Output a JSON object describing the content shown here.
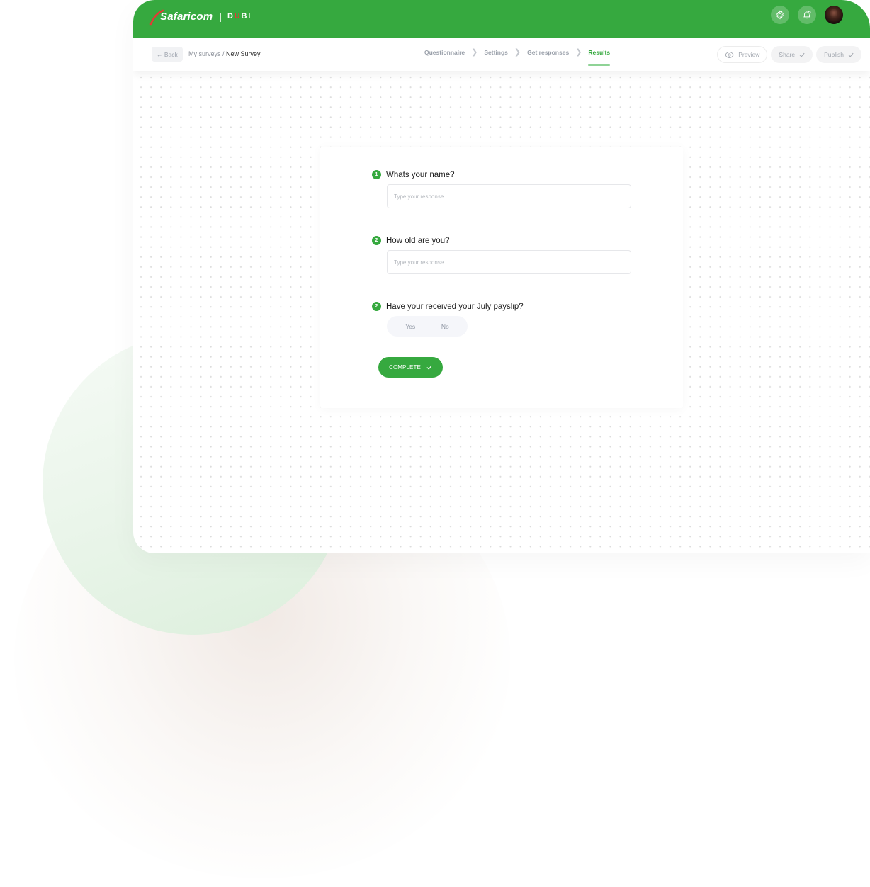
{
  "brand": {
    "name": "Safaricom",
    "separator": "|",
    "product_prefix": "D",
    "product_accent": "U",
    "product_suffix": "BI",
    "primary_color": "#36a93f",
    "accent_color": "#e53935"
  },
  "topbar": {
    "icons": [
      "gear-icon",
      "bell-icon",
      "avatar"
    ]
  },
  "subbar": {
    "back_label": "← Back",
    "breadcrumb": {
      "parent": "My surveys",
      "separator": " / ",
      "current": "New Survey"
    },
    "steps": [
      {
        "label": "Questionnaire",
        "active": false
      },
      {
        "label": "Settings",
        "active": false
      },
      {
        "label": "Get responses",
        "active": false
      },
      {
        "label": "Results",
        "active": true
      }
    ],
    "actions": {
      "preview_label": "Preview",
      "share_label": "Share",
      "publish_label": "Publish"
    }
  },
  "survey": {
    "questions": [
      {
        "number": "1",
        "text": "Whats your name?",
        "type": "text",
        "placeholder": "Type your response",
        "value": ""
      },
      {
        "number": "2",
        "text": "How old are you?",
        "type": "text",
        "placeholder": "Type your response",
        "value": ""
      },
      {
        "number": "2",
        "text": "Have your received your July payslip?",
        "type": "choice",
        "options": [
          "Yes",
          "No"
        ]
      }
    ],
    "complete_label": "COMPLETE"
  }
}
